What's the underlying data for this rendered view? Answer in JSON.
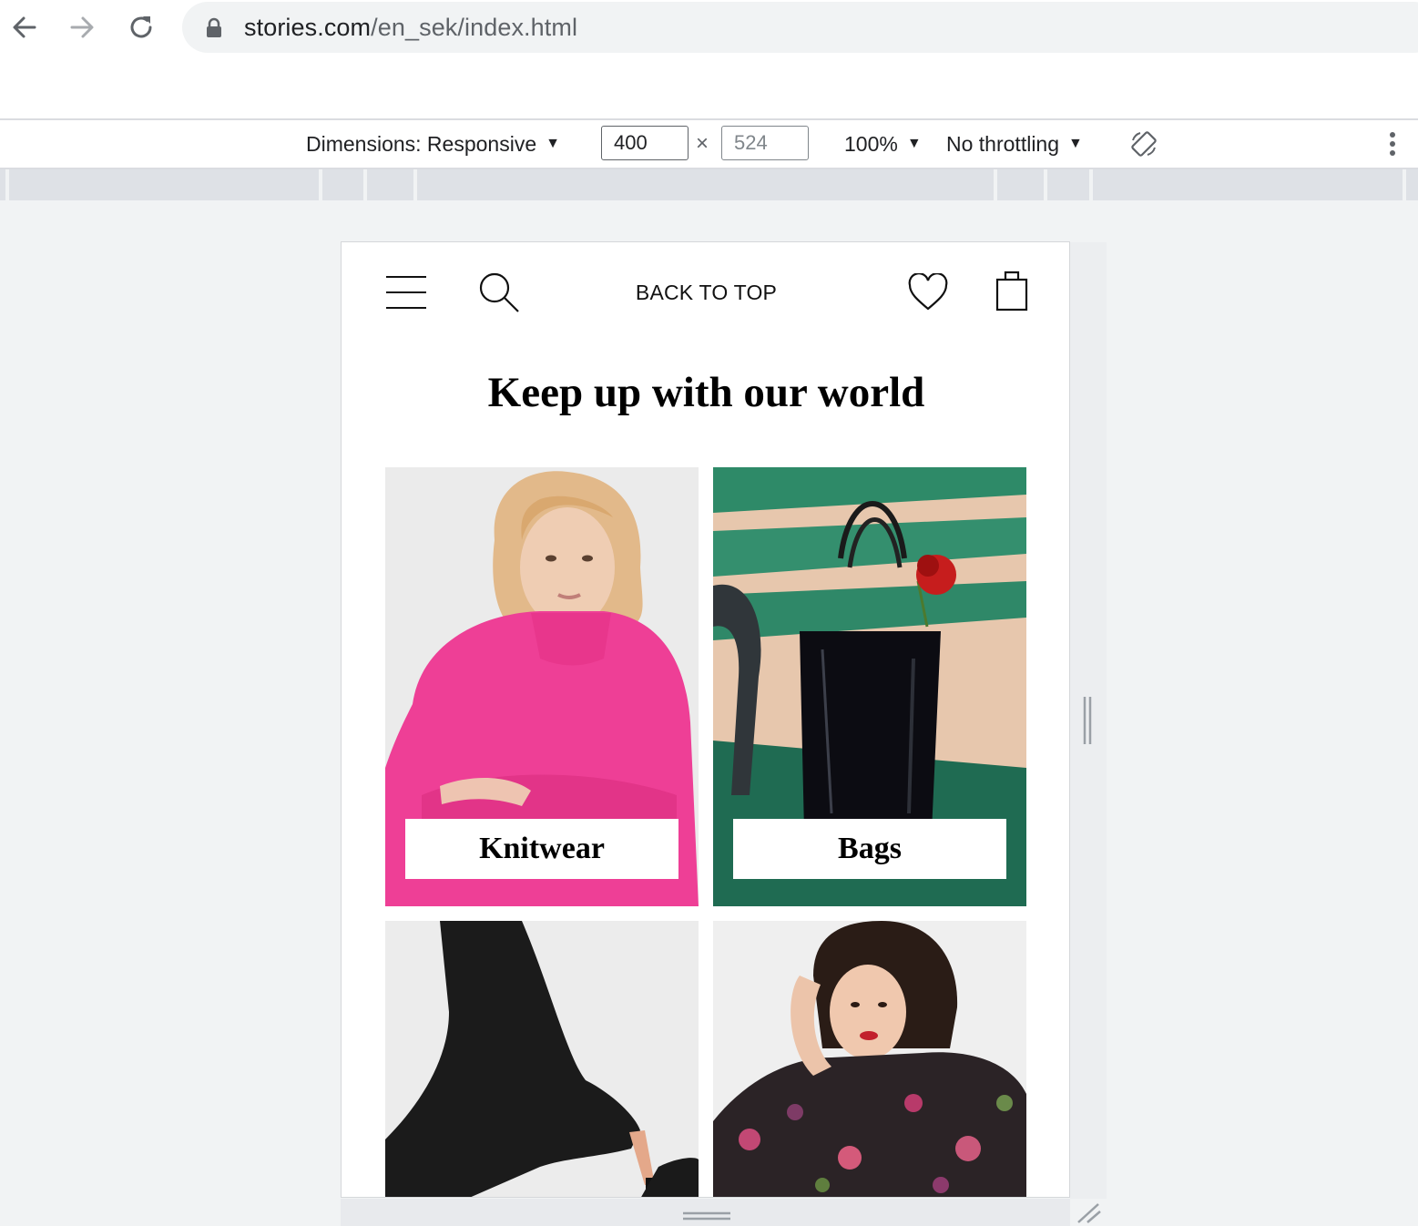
{
  "browser": {
    "url_host": "stories.com",
    "url_path": "/en_sek/index.html",
    "icons": [
      "back-arrow-icon",
      "forward-arrow-icon",
      "reload-icon",
      "lock-icon"
    ]
  },
  "devtools": {
    "dimensions_label": "Dimensions: Responsive",
    "width_value": "400",
    "times": "×",
    "height_value": "524",
    "zoom": "100%",
    "throttling": "No throttling",
    "caret": "▼"
  },
  "site": {
    "back_to_top": "BACK TO TOP",
    "headline": "Keep up with our world",
    "tiles": [
      {
        "label": "Knitwear",
        "image": "woman-pink-sweater"
      },
      {
        "label": "Bags",
        "image": "black-patent-tote-on-bench"
      },
      {
        "label": "",
        "image": "black-knee-boot"
      },
      {
        "label": "",
        "image": "woman-floral-blouse"
      }
    ]
  }
}
